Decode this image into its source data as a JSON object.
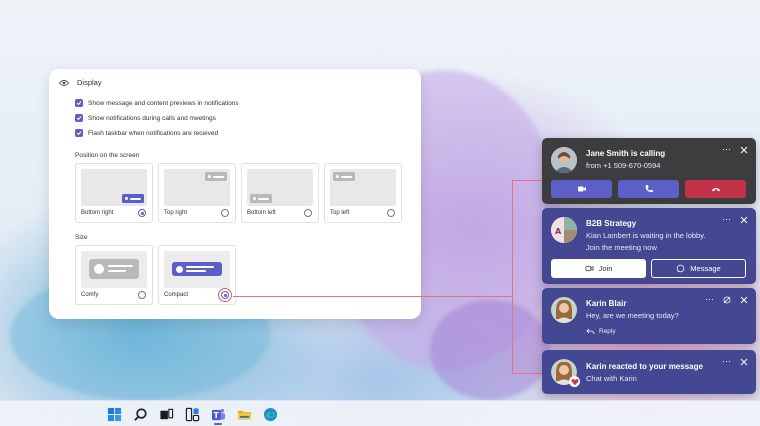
{
  "settings": {
    "header": "Display",
    "checkboxes": [
      {
        "label": "Show message and content previews in notifications",
        "checked": true
      },
      {
        "label": "Show notifications during calls and meetings",
        "checked": true
      },
      {
        "label": "Flash taskbar when notifications are received",
        "checked": true
      }
    ],
    "position_label": "Position on the screen",
    "positions": [
      {
        "label": "Bottom right",
        "selected": true
      },
      {
        "label": "Top right",
        "selected": false
      },
      {
        "label": "Bottom left",
        "selected": false
      },
      {
        "label": "Top left",
        "selected": false
      }
    ],
    "size_label": "Size",
    "sizes": [
      {
        "label": "Comfy",
        "selected": false
      },
      {
        "label": "Compact",
        "selected": true
      }
    ]
  },
  "notifications": {
    "call": {
      "title": "Jane Smith is calling",
      "subtitle": "from +1 509-670-0594",
      "buttons": [
        "video-call-icon",
        "audio-call-icon",
        "decline-call-icon"
      ],
      "colors": {
        "video": "#5b5fc7",
        "audio": "#5b5fc7",
        "decline": "#c4314b"
      }
    },
    "meeting": {
      "title": "B2B Strategy",
      "line1": "Kian Lambert is waiting in the lobby.",
      "line2": "Join the meeting now",
      "join_label": "Join",
      "message_label": "Message"
    },
    "chat": {
      "title": "Karin Blair",
      "message": "Hey, are we meeting today?",
      "reply_label": "Reply"
    },
    "reaction": {
      "title": "Karin reacted to your message",
      "subtitle": "Chat with Karin"
    },
    "more_glyph": "···"
  },
  "taskbar": {
    "icons": [
      "windows-start-icon",
      "search-icon",
      "task-view-icon",
      "widgets-icon",
      "teams-icon",
      "file-explorer-icon",
      "edge-icon"
    ]
  },
  "colors": {
    "accent": "#5b5fc7",
    "notification_bg": "#444791",
    "call_bg": "#3d3d3f",
    "connector": "#e2737f"
  }
}
